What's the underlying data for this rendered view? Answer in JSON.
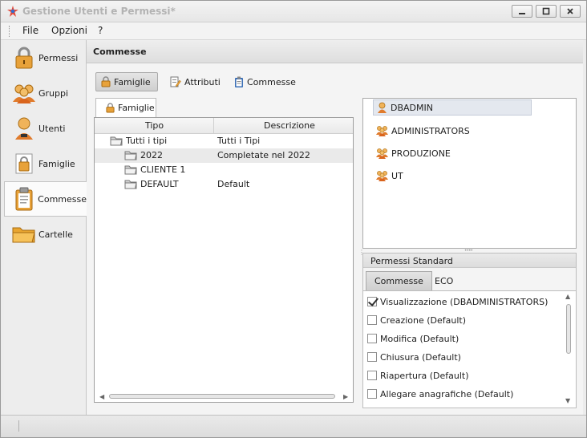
{
  "window": {
    "title": "Gestione Utenti e Permessi*",
    "controls": [
      "minimize",
      "maximize",
      "close"
    ]
  },
  "menu": [
    "File",
    "Opzioni",
    "?"
  ],
  "nav": [
    {
      "label": "Permessi",
      "icon": "lock-icon"
    },
    {
      "label": "Gruppi",
      "icon": "group-icon"
    },
    {
      "label": "Utenti",
      "icon": "user-icon"
    },
    {
      "label": "Famiglie",
      "icon": "lock-doc-icon"
    },
    {
      "label": "Commesse",
      "icon": "clipboard-icon",
      "selected": true
    },
    {
      "label": "Cartelle",
      "icon": "folder-icon"
    }
  ],
  "content": {
    "title": "Commesse",
    "tabs": [
      {
        "label": "Famiglie",
        "active": true
      },
      {
        "label": "Attributi"
      },
      {
        "label": "Commesse"
      }
    ],
    "subtab": "Famiglie",
    "grid": {
      "columns": [
        "Tipo",
        "Descrizione"
      ],
      "rows": [
        {
          "tipo": "Tutti i tipi",
          "descrizione": "Tutti i Tipi",
          "level": 0,
          "expander": "expanded"
        },
        {
          "tipo": "2022",
          "descrizione": "Completate nel 2022",
          "level": 1,
          "expander": "none",
          "highlight": true
        },
        {
          "tipo": "CLIENTE 1",
          "descrizione": "",
          "level": 1,
          "expander": "collapsed"
        },
        {
          "tipo": "DEFAULT",
          "descrizione": "Default",
          "level": 1,
          "expander": "none"
        }
      ]
    },
    "users": [
      {
        "name": "DBADMIN",
        "icon": "user-icon",
        "selected": true
      },
      {
        "name": "ADMINISTRATORS",
        "icon": "group-icon"
      },
      {
        "name": "PRODUZIONE",
        "icon": "group-icon"
      },
      {
        "name": "UT",
        "icon": "group-icon"
      }
    ],
    "permissions": {
      "title": "Permessi Standard",
      "tabs": [
        {
          "label": "Commesse",
          "active": true
        },
        {
          "label": "ECO"
        }
      ],
      "items": [
        {
          "label": "Visualizzazione (DBADMINISTRATORS)",
          "checked": true
        },
        {
          "label": "Creazione (Default)",
          "checked": false
        },
        {
          "label": "Modifica (Default)",
          "checked": false
        },
        {
          "label": "Chiusura (Default)",
          "checked": false
        },
        {
          "label": "Riapertura (Default)",
          "checked": false
        },
        {
          "label": "Allegare anagrafiche (Default)",
          "checked": false
        }
      ]
    }
  },
  "colors": {
    "accent_orange": "#e8a23a",
    "folder_gray": "#9a9a9a",
    "selection_bg": "#e4e8ef"
  }
}
